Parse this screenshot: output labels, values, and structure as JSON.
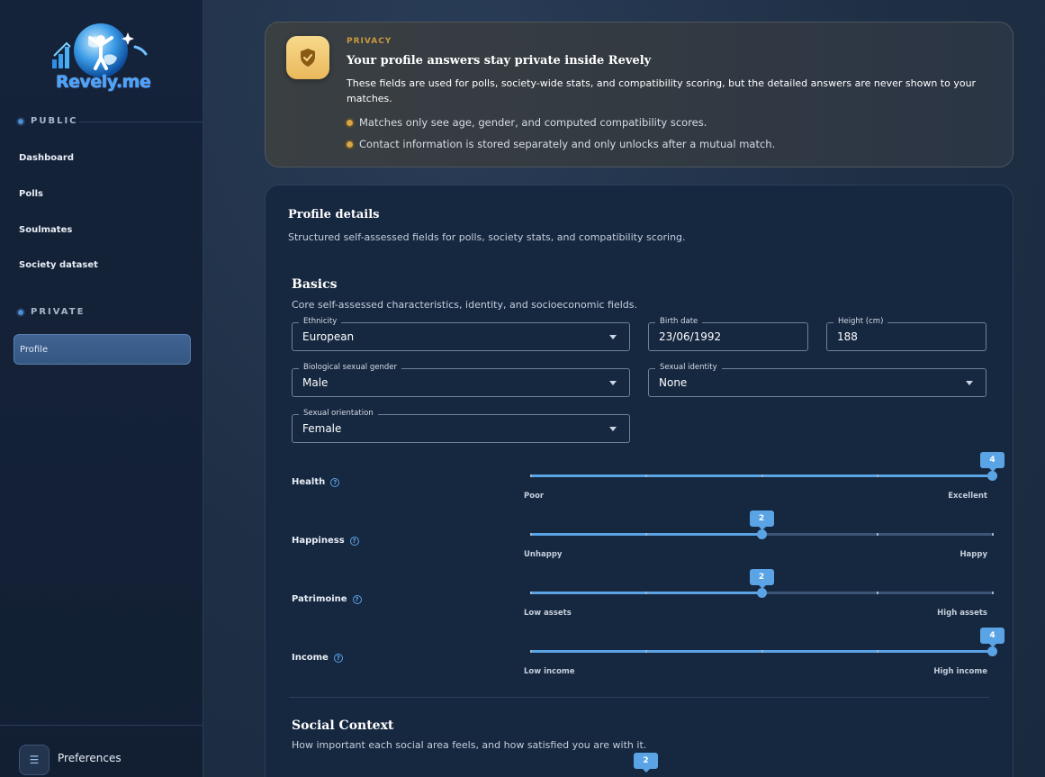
{
  "app": {
    "logo_text": "Revely.me"
  },
  "sidebar": {
    "public_label": "PUBLIC",
    "private_label": "PRIVATE",
    "public_items": [
      {
        "label": "Dashboard"
      },
      {
        "label": "Polls"
      },
      {
        "label": "Soulmates"
      },
      {
        "label": "Society dataset"
      }
    ],
    "private_items": [
      {
        "label": "Profile",
        "active": true
      }
    ],
    "footer": {
      "label": "Preferences",
      "icon": "sliders-icon"
    }
  },
  "privacy": {
    "eyebrow": "PRIVACY",
    "title": "Your profile answers stay private inside Revely",
    "description": "These fields are used for polls, society-wide stats, and compatibility scoring, but the detailed answers are never shown to your matches.",
    "bullets": [
      "Matches only see age, gender, and computed compatibility scores.",
      "Contact information is stored separately and only unlocks after a mutual match."
    ],
    "icon": "shield-icon",
    "accent": "#eab85b"
  },
  "profile": {
    "title": "Profile details",
    "subtitle": "Structured self-assessed fields for polls, society stats, and compatibility scoring.",
    "basics": {
      "title": "Basics",
      "subtitle": "Core self-assessed characteristics, identity, and socioeconomic fields.",
      "fields": {
        "ethnicity": {
          "label": "Ethnicity",
          "value": "European"
        },
        "birth_date": {
          "label": "Birth date",
          "value": "23/06/1992"
        },
        "height": {
          "label": "Height (cm)",
          "value": "188"
        },
        "bio_gender": {
          "label": "Biological sexual gender",
          "value": "Male"
        },
        "sexual_identity": {
          "label": "Sexual identity",
          "value": "None"
        },
        "orientation": {
          "label": "Sexual orientation",
          "value": "Female"
        }
      },
      "sliders": [
        {
          "label": "Health",
          "value": 4,
          "min_label": "Poor",
          "max_label": "Excellent"
        },
        {
          "label": "Happiness",
          "value": 2,
          "min_label": "Unhappy",
          "max_label": "Happy"
        },
        {
          "label": "Patrimoine",
          "value": 2,
          "min_label": "Low assets",
          "max_label": "High assets"
        },
        {
          "label": "Income",
          "value": 4,
          "min_label": "Low income",
          "max_label": "High income"
        }
      ]
    },
    "social": {
      "title": "Social Context",
      "subtitle": "How important each social area feels, and how satisfied you are with it.",
      "first_slider_value": "2"
    }
  },
  "colors": {
    "accent": "#5aa4e6",
    "active_nav": "#3f6393"
  }
}
